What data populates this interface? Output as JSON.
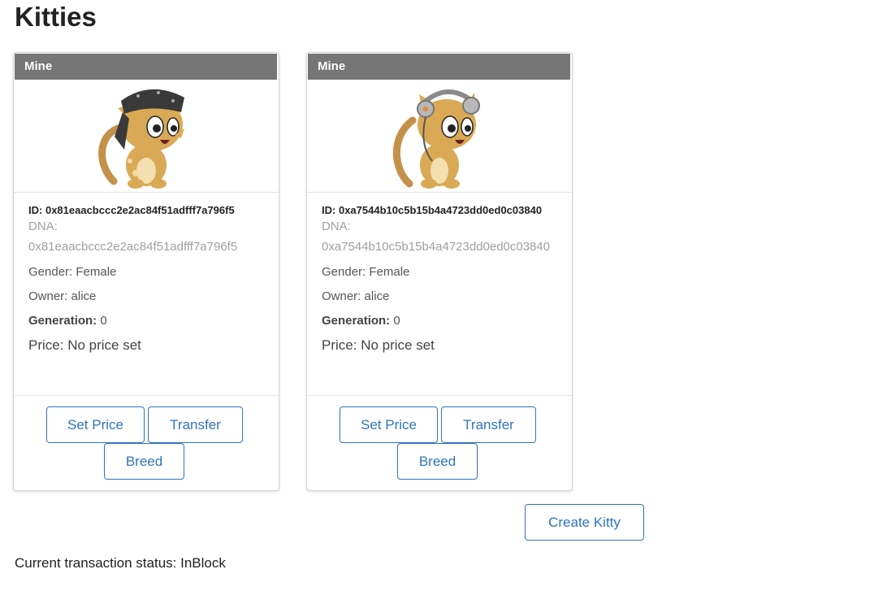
{
  "page": {
    "title": "Kitties"
  },
  "kitties": [
    {
      "header": "Mine",
      "accessory": "bandana",
      "id_label": "ID:",
      "id": "0x81eaacbccc2e2ac84f51adfff7a796f5",
      "dna_label": "DNA:",
      "dna": "0x81eaacbccc2e2ac84f51adfff7a796f5",
      "gender_label": "Gender:",
      "gender": "Female",
      "owner_label": "Owner:",
      "owner": "alice",
      "generation_label": "Generation:",
      "generation": "0",
      "price_label": "Price:",
      "price": "No price set",
      "buttons": {
        "set_price": "Set Price",
        "transfer": "Transfer",
        "breed": "Breed"
      }
    },
    {
      "header": "Mine",
      "accessory": "headphones",
      "id_label": "ID:",
      "id": "0xa7544b10c5b15b4a4723dd0ed0c03840",
      "dna_label": "DNA:",
      "dna": "0xa7544b10c5b15b4a4723dd0ed0c03840",
      "gender_label": "Gender:",
      "gender": "Female",
      "owner_label": "Owner:",
      "owner": "alice",
      "generation_label": "Generation:",
      "generation": "0",
      "price_label": "Price:",
      "price": "No price set",
      "buttons": {
        "set_price": "Set Price",
        "transfer": "Transfer",
        "breed": "Breed"
      }
    }
  ],
  "actions": {
    "create_kitty": "Create Kitty"
  },
  "status": {
    "label": "Current transaction status:",
    "value": "InBlock"
  },
  "colors": {
    "header_bg": "#767676",
    "button": "#2f74c0",
    "cat_fur": "#d9a955"
  }
}
